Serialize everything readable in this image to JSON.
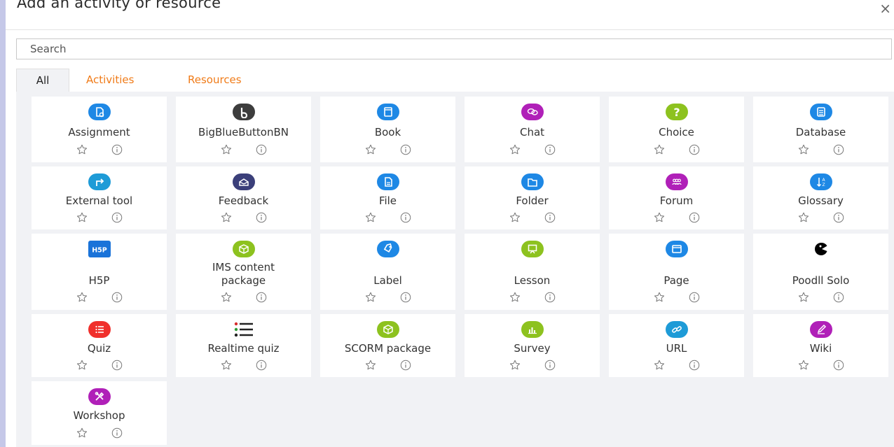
{
  "dialog": {
    "title": "Add an activity or resource",
    "close_label": "×"
  },
  "search": {
    "placeholder": "Search"
  },
  "tabs": [
    {
      "label": "All",
      "active": true
    },
    {
      "label": "Activities",
      "active": false
    },
    {
      "label": "Resources",
      "active": false
    }
  ],
  "items": [
    {
      "name": "Assignment",
      "icon": "assignment-icon",
      "color": "#1e88e5"
    },
    {
      "name": "BigBlueButtonBN",
      "icon": "bigbluebutton-icon",
      "color": "#3d3d3d"
    },
    {
      "name": "Book",
      "icon": "book-icon",
      "color": "#1e88e5"
    },
    {
      "name": "Chat",
      "icon": "chat-icon",
      "color": "#b020b8"
    },
    {
      "name": "Choice",
      "icon": "choice-icon",
      "color": "#8dc21f"
    },
    {
      "name": "Database",
      "icon": "database-icon",
      "color": "#1e88e5"
    },
    {
      "name": "External tool",
      "icon": "external-tool-icon",
      "color": "#1e9bd7"
    },
    {
      "name": "Feedback",
      "icon": "feedback-icon",
      "color": "#3b3f7a"
    },
    {
      "name": "File",
      "icon": "file-icon",
      "color": "#1e88e5"
    },
    {
      "name": "Folder",
      "icon": "folder-icon",
      "color": "#1e88e5"
    },
    {
      "name": "Forum",
      "icon": "forum-icon",
      "color": "#b020b8"
    },
    {
      "name": "Glossary",
      "icon": "glossary-icon",
      "color": "#1e88e5"
    },
    {
      "name": "H5P",
      "icon": "h5p-icon",
      "color": "#1a73d9"
    },
    {
      "name": "IMS content\npackage",
      "icon": "ims-package-icon",
      "color": "#8dc21f"
    },
    {
      "name": "Label",
      "icon": "label-icon",
      "color": "#1e88e5"
    },
    {
      "name": "Lesson",
      "icon": "lesson-icon",
      "color": "#8dc21f"
    },
    {
      "name": "Page",
      "icon": "page-icon",
      "color": "#1e88e5"
    },
    {
      "name": "Poodll Solo",
      "icon": "poodll-solo-icon",
      "color": "#000000"
    },
    {
      "name": "Quiz",
      "icon": "quiz-icon",
      "color": "#f0302c"
    },
    {
      "name": "Realtime quiz",
      "icon": "realtime-quiz-icon",
      "color": "#222222"
    },
    {
      "name": "SCORM package",
      "icon": "scorm-package-icon",
      "color": "#8dc21f"
    },
    {
      "name": "Survey",
      "icon": "survey-icon",
      "color": "#8dc21f"
    },
    {
      "name": "URL",
      "icon": "url-icon",
      "color": "#1e9bd7"
    },
    {
      "name": "Wiki",
      "icon": "wiki-icon",
      "color": "#b020b8"
    },
    {
      "name": "Workshop",
      "icon": "workshop-icon",
      "color": "#b020b8"
    }
  ],
  "action_icons": {
    "star": "star-outline-icon",
    "info": "info-circle-icon",
    "color": "#777777"
  }
}
